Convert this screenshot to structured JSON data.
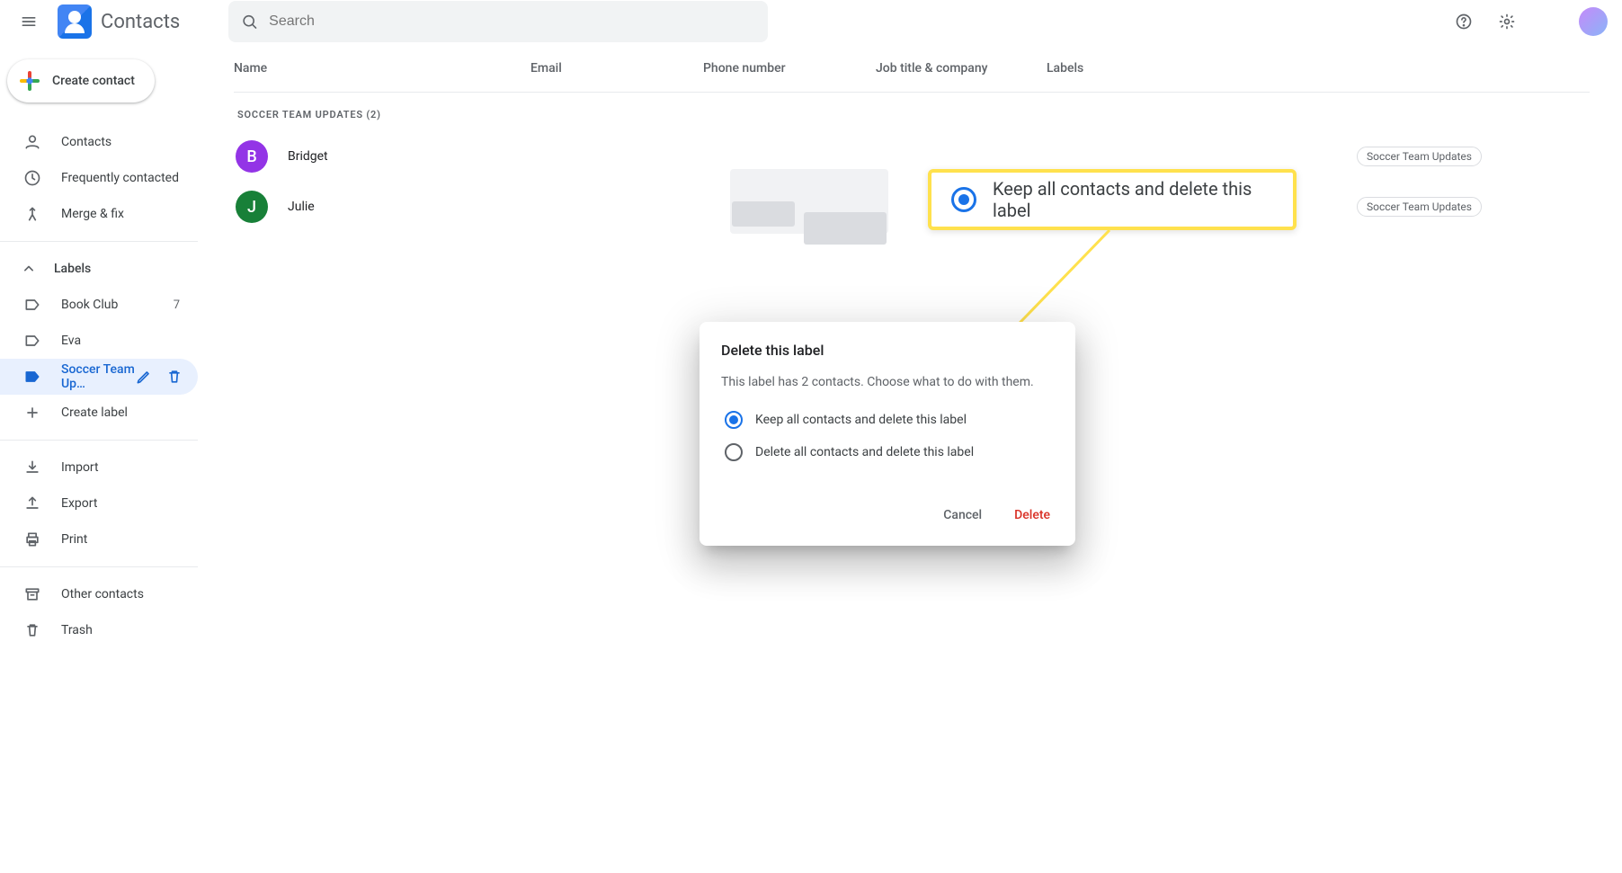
{
  "app": {
    "title": "Contacts"
  },
  "search": {
    "placeholder": "Search"
  },
  "sidebar": {
    "create_label": "Create contact",
    "nav": {
      "contacts": "Contacts",
      "frequent": "Frequently contacted",
      "merge": "Merge & fix"
    },
    "labels_header": "Labels",
    "labels": [
      {
        "name": "Book Club",
        "count": "7"
      },
      {
        "name": "Eva",
        "count": ""
      },
      {
        "name": "Soccer Team Up…",
        "count": ""
      }
    ],
    "create_label_item": "Create label",
    "import": "Import",
    "export": "Export",
    "print": "Print",
    "other": "Other contacts",
    "trash": "Trash"
  },
  "columns": {
    "name": "Name",
    "email": "Email",
    "phone": "Phone number",
    "job": "Job title & company",
    "labels": "Labels"
  },
  "group": {
    "title": "Soccer Team Updates (2)"
  },
  "contacts": [
    {
      "initial": "B",
      "name": "Bridget",
      "avatar_color": "#9334e6",
      "chip": "Soccer Team Updates"
    },
    {
      "initial": "J",
      "name": "Julie",
      "avatar_color": "#188038",
      "chip": "Soccer Team Updates"
    }
  ],
  "dialog": {
    "title": "Delete this label",
    "body": "This label has 2 contacts. Choose what to do with them.",
    "opt_keep": "Keep all contacts and delete this label",
    "opt_delete": "Delete all contacts and delete this label",
    "cancel": "Cancel",
    "delete": "Delete"
  },
  "callout": {
    "text": "Keep all contacts and delete this label"
  }
}
